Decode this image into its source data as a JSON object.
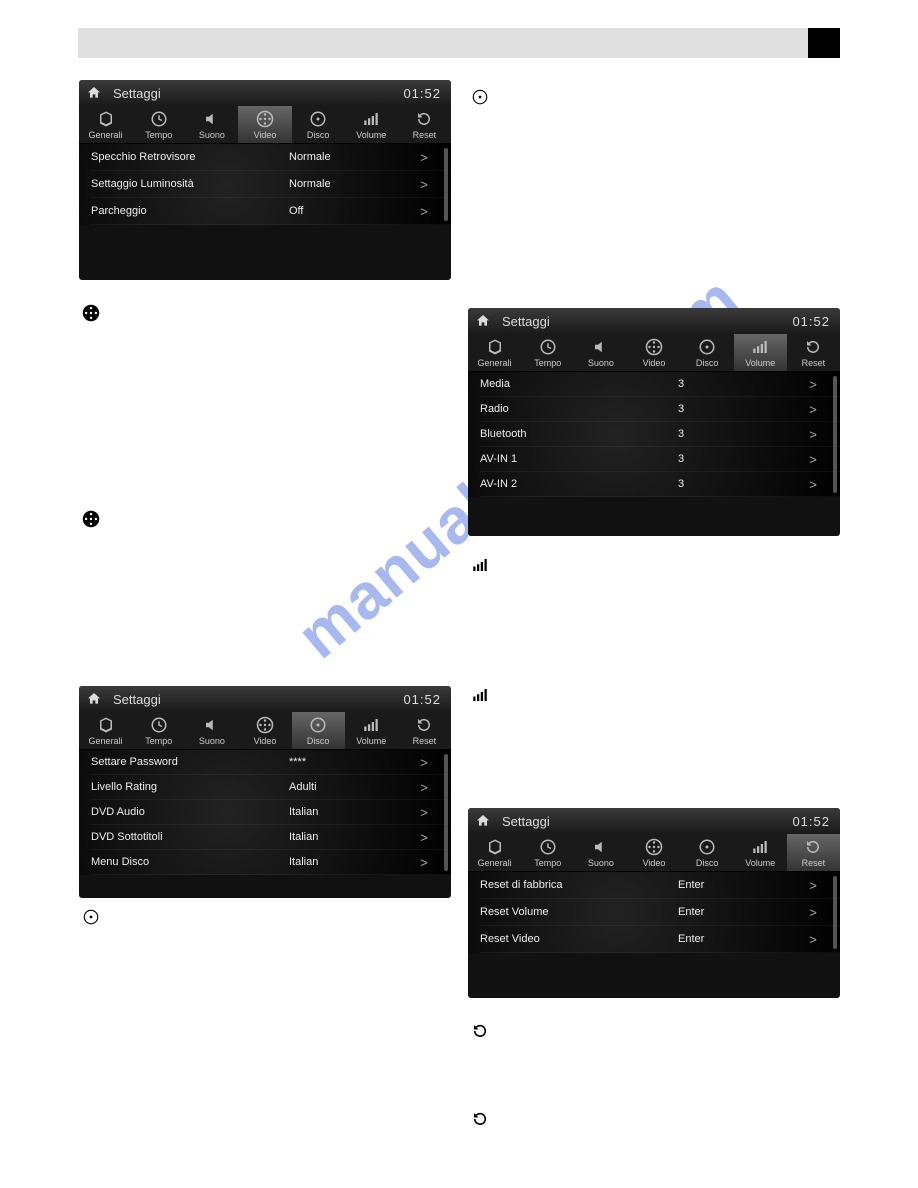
{
  "watermark": "manualshive.com",
  "device_common": {
    "title": "Settaggi",
    "time": "01:52",
    "tabs": [
      "Generali",
      "Tempo",
      "Suono",
      "Video",
      "Disco",
      "Volume",
      "Reset"
    ]
  },
  "screen_video": {
    "active_tab": 3,
    "rows": [
      {
        "label": "Specchio Retrovisore",
        "value": "Normale"
      },
      {
        "label": "Settaggio Luminosità",
        "value": "Normale"
      },
      {
        "label": "Parcheggio",
        "value": "Off"
      }
    ]
  },
  "screen_disco": {
    "active_tab": 4,
    "rows": [
      {
        "label": "Settare Password",
        "value": "****"
      },
      {
        "label": "Livello Rating",
        "value": "Adulti"
      },
      {
        "label": "DVD Audio",
        "value": "Italian"
      },
      {
        "label": "DVD Sottotitoli",
        "value": "Italian"
      },
      {
        "label": "Menu Disco",
        "value": "Italian"
      }
    ]
  },
  "screen_volume": {
    "active_tab": 5,
    "rows": [
      {
        "label": "Media",
        "value": "3"
      },
      {
        "label": "Radio",
        "value": "3"
      },
      {
        "label": "Bluetooth",
        "value": "3"
      },
      {
        "label": "AV-IN 1",
        "value": "3"
      },
      {
        "label": "AV-IN 2",
        "value": "3"
      }
    ]
  },
  "screen_reset": {
    "active_tab": 6,
    "rows": [
      {
        "label": "Reset di fabbrica",
        "value": "Enter"
      },
      {
        "label": "Reset Volume",
        "value": "Enter"
      },
      {
        "label": "Reset Video",
        "value": "Enter"
      }
    ]
  }
}
